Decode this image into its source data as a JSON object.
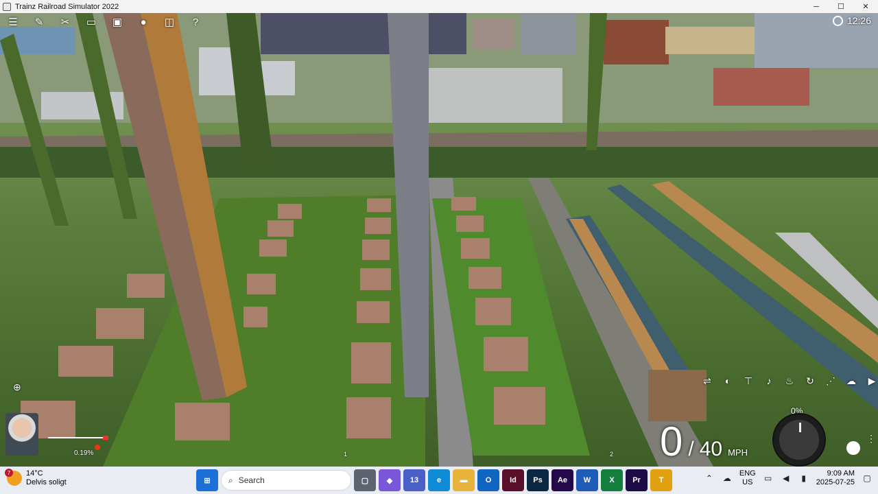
{
  "window": {
    "title": "Trainz Railroad Simulator 2022",
    "minimize": "─",
    "maximize": "☐",
    "close": "✕"
  },
  "hud": {
    "top_icons": [
      "menu-icon",
      "edit-icon",
      "tools-icon",
      "chat-icon",
      "camera-icon",
      "message-icon",
      "window-icon",
      "help-icon"
    ],
    "top_glyphs": [
      "☰",
      "✎",
      "✂",
      "▭",
      "▣",
      "●",
      "◫",
      "?"
    ],
    "clock": "12:26",
    "grade_percent": "0.19%",
    "track_marker_1": "1",
    "track_marker_2": "2",
    "throttle_percent": "0%",
    "speed_current": "0",
    "speed_separator": "/",
    "speed_limit": "40",
    "speed_unit": "MPH",
    "left_tool_glyph": "⊕",
    "controls": [
      {
        "name": "coupler-icon",
        "glyph": "⇌"
      },
      {
        "name": "headlight-icon",
        "glyph": "◐"
      },
      {
        "name": "pantograph-icon",
        "glyph": "⊤"
      },
      {
        "name": "horn-icon",
        "glyph": "♪"
      },
      {
        "name": "bell-icon",
        "glyph": "♨"
      },
      {
        "name": "reverser-icon",
        "glyph": "↻"
      },
      {
        "name": "sander-icon",
        "glyph": "⋰"
      },
      {
        "name": "smoke-icon",
        "glyph": "☁"
      },
      {
        "name": "play-icon",
        "glyph": "▶"
      }
    ],
    "menu_glyph": "⋮"
  },
  "taskbar": {
    "weather_temp": "14°C",
    "weather_desc": "Delvis soligt",
    "weather_badge": "7",
    "search_placeholder": "Search",
    "apps": [
      {
        "name": "start-icon",
        "label": "⊞",
        "color": "#1b6fd6"
      },
      {
        "name": "taskview-icon",
        "label": "▢",
        "color": "#5d6470"
      },
      {
        "name": "copilot-icon",
        "label": "◆",
        "color": "#7a56d8"
      },
      {
        "name": "teams-icon",
        "label": "13",
        "color": "#4b5fc8"
      },
      {
        "name": "edge-icon",
        "label": "e",
        "color": "#0f8ad6"
      },
      {
        "name": "explorer-icon",
        "label": "▬",
        "color": "#e8b33a"
      },
      {
        "name": "outlook-icon",
        "label": "O",
        "color": "#1065c0"
      },
      {
        "name": "indesign-icon",
        "label": "Id",
        "color": "#5a0f28"
      },
      {
        "name": "photoshop-icon",
        "label": "Ps",
        "color": "#0a2744"
      },
      {
        "name": "aftereffects-icon",
        "label": "Ae",
        "color": "#240a4a"
      },
      {
        "name": "word-icon",
        "label": "W",
        "color": "#1f5bb8"
      },
      {
        "name": "excel-icon",
        "label": "X",
        "color": "#15803d"
      },
      {
        "name": "premiere-icon",
        "label": "Pr",
        "color": "#1c0b45"
      },
      {
        "name": "trainz-icon",
        "label": "T",
        "color": "#e0a010"
      }
    ],
    "lang_top": "ENG",
    "lang_bottom": "US",
    "time": "9:09 AM",
    "date": "2025-07-25"
  }
}
